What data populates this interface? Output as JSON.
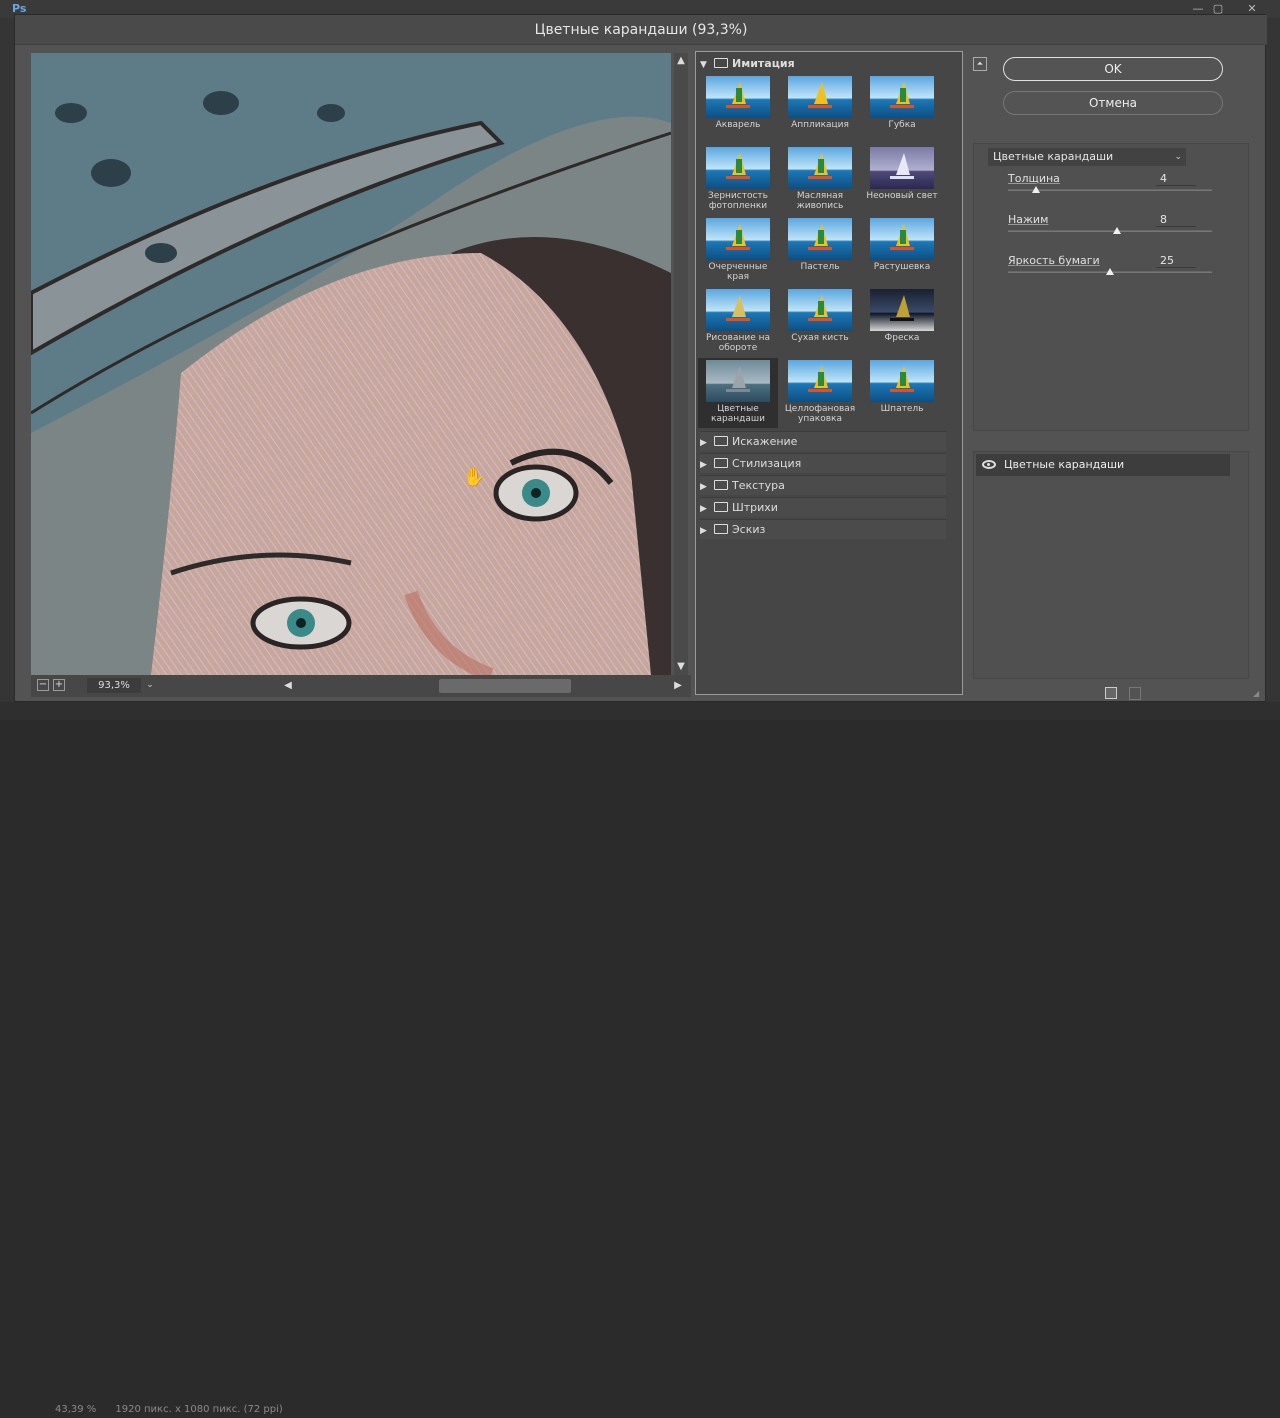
{
  "app": {
    "logo": "Ps",
    "status_left": "43,39 %",
    "status_doc": "1920 пикс. x 1080 пикс. (72 ppi)"
  },
  "dialog": {
    "title": "Цветные карандаши (93,3%)"
  },
  "preview": {
    "zoom": "93,3%",
    "zoom_minus": "−",
    "zoom_plus": "+"
  },
  "gallery": {
    "open_folder": "Имитация",
    "filters": [
      {
        "label": "Акварель"
      },
      {
        "label": "Аппликация"
      },
      {
        "label": "Губка"
      },
      {
        "label": "Зернистость фотопленки"
      },
      {
        "label": "Масляная живопись"
      },
      {
        "label": "Неоновый свет"
      },
      {
        "label": "Очерченные края"
      },
      {
        "label": "Пастель"
      },
      {
        "label": "Растушевка"
      },
      {
        "label": "Рисование на обороте"
      },
      {
        "label": "Сухая кисть"
      },
      {
        "label": "Фреска"
      },
      {
        "label": "Цветные карандаши",
        "selected": true
      },
      {
        "label": "Целлофановая упаковка"
      },
      {
        "label": "Шпатель"
      }
    ],
    "categories": [
      "Искажение",
      "Стилизация",
      "Текстура",
      "Штрихи",
      "Эскиз"
    ]
  },
  "buttons": {
    "ok": "OK",
    "cancel": "Отмена"
  },
  "settings": {
    "filter_select": "Цветные карандаши",
    "params": [
      {
        "label": "Толщина",
        "value": "4",
        "min": 1,
        "max": 24
      },
      {
        "label": "Нажим",
        "value": "8",
        "min": 0,
        "max": 15
      },
      {
        "label": "Яркость бумаги",
        "value": "25",
        "min": 0,
        "max": 50
      }
    ]
  },
  "layers": {
    "items": [
      {
        "label": "Цветные карандаши"
      }
    ]
  },
  "colors": {
    "accent": "#e6e6e6",
    "dialog_bg": "#535353",
    "panel_bg": "#464646"
  }
}
